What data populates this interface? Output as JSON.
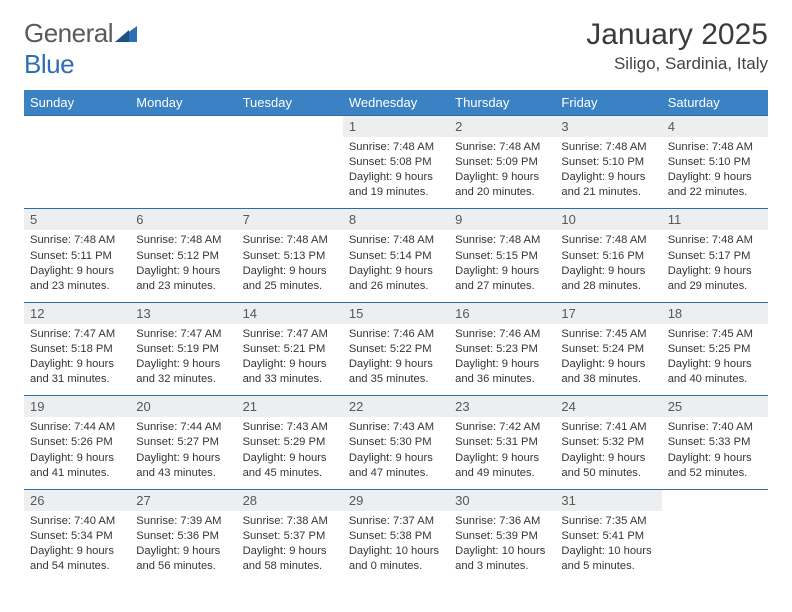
{
  "brand": {
    "part1": "General",
    "part2": "Blue"
  },
  "title": "January 2025",
  "location": "Siligo, Sardinia, Italy",
  "dayNames": [
    "Sunday",
    "Monday",
    "Tuesday",
    "Wednesday",
    "Thursday",
    "Friday",
    "Saturday"
  ],
  "weeks": [
    [
      null,
      null,
      null,
      {
        "n": 1,
        "sr": "7:48 AM",
        "ss": "5:08 PM",
        "dl": "9 hours and 19 minutes."
      },
      {
        "n": 2,
        "sr": "7:48 AM",
        "ss": "5:09 PM",
        "dl": "9 hours and 20 minutes."
      },
      {
        "n": 3,
        "sr": "7:48 AM",
        "ss": "5:10 PM",
        "dl": "9 hours and 21 minutes."
      },
      {
        "n": 4,
        "sr": "7:48 AM",
        "ss": "5:10 PM",
        "dl": "9 hours and 22 minutes."
      }
    ],
    [
      {
        "n": 5,
        "sr": "7:48 AM",
        "ss": "5:11 PM",
        "dl": "9 hours and 23 minutes."
      },
      {
        "n": 6,
        "sr": "7:48 AM",
        "ss": "5:12 PM",
        "dl": "9 hours and 23 minutes."
      },
      {
        "n": 7,
        "sr": "7:48 AM",
        "ss": "5:13 PM",
        "dl": "9 hours and 25 minutes."
      },
      {
        "n": 8,
        "sr": "7:48 AM",
        "ss": "5:14 PM",
        "dl": "9 hours and 26 minutes."
      },
      {
        "n": 9,
        "sr": "7:48 AM",
        "ss": "5:15 PM",
        "dl": "9 hours and 27 minutes."
      },
      {
        "n": 10,
        "sr": "7:48 AM",
        "ss": "5:16 PM",
        "dl": "9 hours and 28 minutes."
      },
      {
        "n": 11,
        "sr": "7:48 AM",
        "ss": "5:17 PM",
        "dl": "9 hours and 29 minutes."
      }
    ],
    [
      {
        "n": 12,
        "sr": "7:47 AM",
        "ss": "5:18 PM",
        "dl": "9 hours and 31 minutes."
      },
      {
        "n": 13,
        "sr": "7:47 AM",
        "ss": "5:19 PM",
        "dl": "9 hours and 32 minutes."
      },
      {
        "n": 14,
        "sr": "7:47 AM",
        "ss": "5:21 PM",
        "dl": "9 hours and 33 minutes."
      },
      {
        "n": 15,
        "sr": "7:46 AM",
        "ss": "5:22 PM",
        "dl": "9 hours and 35 minutes."
      },
      {
        "n": 16,
        "sr": "7:46 AM",
        "ss": "5:23 PM",
        "dl": "9 hours and 36 minutes."
      },
      {
        "n": 17,
        "sr": "7:45 AM",
        "ss": "5:24 PM",
        "dl": "9 hours and 38 minutes."
      },
      {
        "n": 18,
        "sr": "7:45 AM",
        "ss": "5:25 PM",
        "dl": "9 hours and 40 minutes."
      }
    ],
    [
      {
        "n": 19,
        "sr": "7:44 AM",
        "ss": "5:26 PM",
        "dl": "9 hours and 41 minutes."
      },
      {
        "n": 20,
        "sr": "7:44 AM",
        "ss": "5:27 PM",
        "dl": "9 hours and 43 minutes."
      },
      {
        "n": 21,
        "sr": "7:43 AM",
        "ss": "5:29 PM",
        "dl": "9 hours and 45 minutes."
      },
      {
        "n": 22,
        "sr": "7:43 AM",
        "ss": "5:30 PM",
        "dl": "9 hours and 47 minutes."
      },
      {
        "n": 23,
        "sr": "7:42 AM",
        "ss": "5:31 PM",
        "dl": "9 hours and 49 minutes."
      },
      {
        "n": 24,
        "sr": "7:41 AM",
        "ss": "5:32 PM",
        "dl": "9 hours and 50 minutes."
      },
      {
        "n": 25,
        "sr": "7:40 AM",
        "ss": "5:33 PM",
        "dl": "9 hours and 52 minutes."
      }
    ],
    [
      {
        "n": 26,
        "sr": "7:40 AM",
        "ss": "5:34 PM",
        "dl": "9 hours and 54 minutes."
      },
      {
        "n": 27,
        "sr": "7:39 AM",
        "ss": "5:36 PM",
        "dl": "9 hours and 56 minutes."
      },
      {
        "n": 28,
        "sr": "7:38 AM",
        "ss": "5:37 PM",
        "dl": "9 hours and 58 minutes."
      },
      {
        "n": 29,
        "sr": "7:37 AM",
        "ss": "5:38 PM",
        "dl": "10 hours and 0 minutes."
      },
      {
        "n": 30,
        "sr": "7:36 AM",
        "ss": "5:39 PM",
        "dl": "10 hours and 3 minutes."
      },
      {
        "n": 31,
        "sr": "7:35 AM",
        "ss": "5:41 PM",
        "dl": "10 hours and 5 minutes."
      },
      null
    ]
  ],
  "labels": {
    "sunrise": "Sunrise:",
    "sunset": "Sunset:",
    "daylight": "Daylight:"
  }
}
